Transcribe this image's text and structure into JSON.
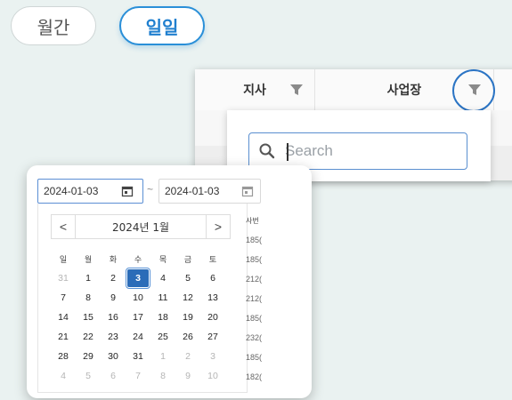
{
  "toggle": {
    "monthly_label": "월간",
    "daily_label": "일일"
  },
  "grid": {
    "columns": [
      {
        "label": "지사"
      },
      {
        "label": "사업장"
      }
    ]
  },
  "filter_dropdown": {
    "search_placeholder": "Search"
  },
  "date_range": {
    "start": "2024-01-03",
    "separator": "~",
    "end": "2024-01-03"
  },
  "calendar": {
    "prev_label": "<",
    "next_label": ">",
    "title": "2024년 1월",
    "weekdays": [
      "일",
      "월",
      "화",
      "수",
      "목",
      "금",
      "토"
    ],
    "weeks": [
      [
        "31",
        "1",
        "2",
        "3",
        "4",
        "5",
        "6"
      ],
      [
        "7",
        "8",
        "9",
        "10",
        "11",
        "12",
        "13"
      ],
      [
        "14",
        "15",
        "16",
        "17",
        "18",
        "19",
        "20"
      ],
      [
        "21",
        "22",
        "23",
        "24",
        "25",
        "26",
        "27"
      ],
      [
        "28",
        "29",
        "30",
        "31",
        "1",
        "2",
        "3"
      ],
      [
        "4",
        "5",
        "6",
        "7",
        "8",
        "9",
        "10"
      ]
    ],
    "selected_day": "3"
  },
  "side_column": {
    "header": "사번",
    "cells": [
      "185(",
      "185(",
      "212(",
      "212(",
      "185(",
      "232(",
      "185(",
      "182("
    ]
  },
  "colors": {
    "accent": "#2a8fd8",
    "selected_day_bg": "#2b6cb8",
    "highlight_circle": "#2b74c4"
  }
}
